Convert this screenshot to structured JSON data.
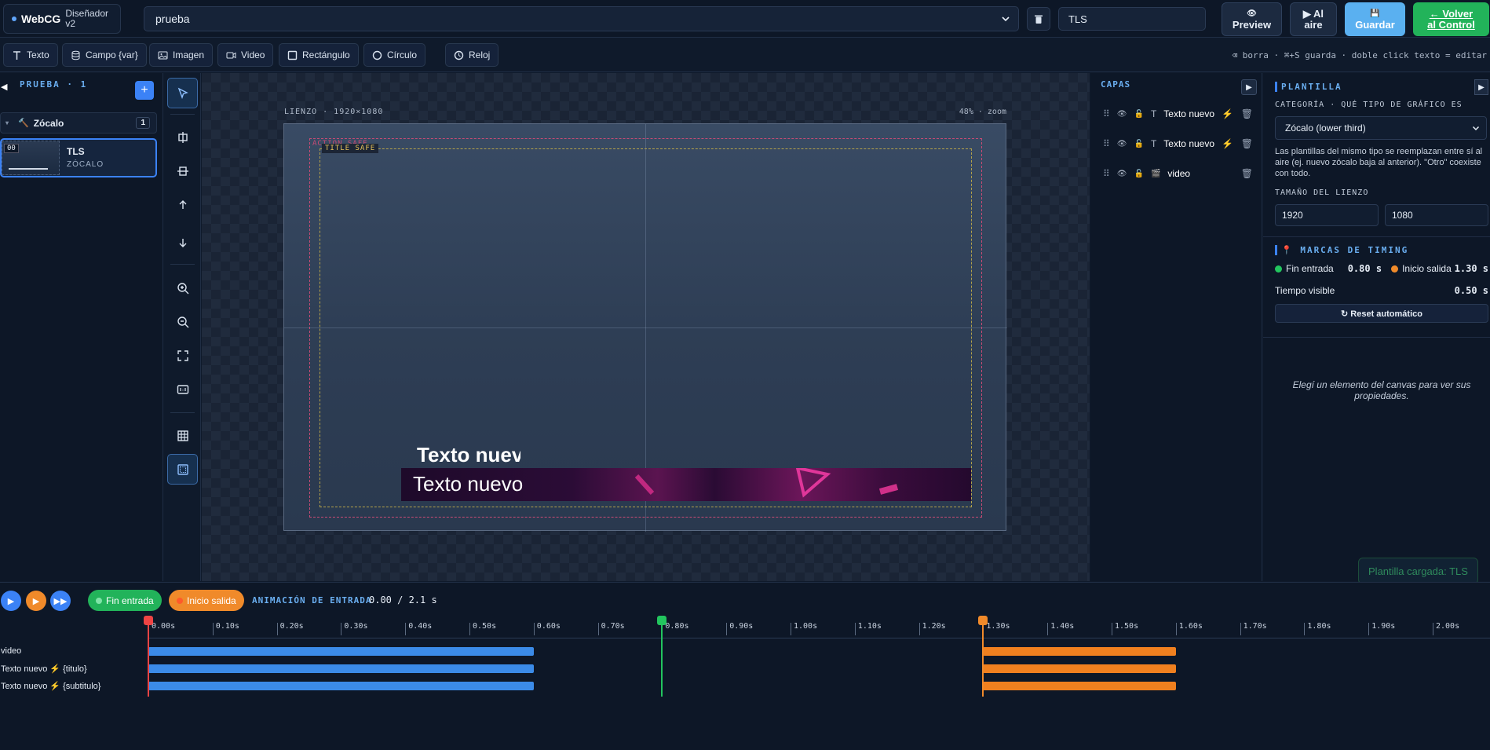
{
  "app": {
    "name": "WebCG",
    "subtitle": "Diseñador v2"
  },
  "topbar": {
    "template_selected": "prueba",
    "name_value": "TLS",
    "preview_label": "Preview",
    "aire_label1": "▶ Al",
    "aire_label2": "aire",
    "save_label": "Guardar",
    "volver_label1": "← Volver",
    "volver_label2": "al Control"
  },
  "toolbar": {
    "tools": [
      "Texto",
      "Campo {var}",
      "Imagen",
      "Video",
      "Rectángulo",
      "Círculo",
      "Reloj"
    ],
    "hint": "⌫ borra · ⌘+S guarda · doble click texto = editar"
  },
  "left": {
    "title": "PRUEBA · 1",
    "category": "Zócalo",
    "category_count": "1",
    "item_name": "TLS",
    "item_type": "ZÓCALO",
    "thumb_badge": "00"
  },
  "canvas": {
    "label": "LIENZO · 1920×1080",
    "zoom": "48% · zoom",
    "action_safe": "ACTION SAFE",
    "title_safe": "TITLE SAFE",
    "text_title": "Texto nuevo",
    "text_sub": "Texto nuevo"
  },
  "layers": {
    "title": "CAPAS",
    "items": [
      {
        "type": "T",
        "name": "Texto nuevo",
        "dynamic": true
      },
      {
        "type": "T",
        "name": "Texto nuevo",
        "dynamic": true
      },
      {
        "type": "🎬",
        "name": "video",
        "dynamic": false
      }
    ]
  },
  "props": {
    "section": "PLANTILLA",
    "category_label": "CATEGORÍA · QUÉ TIPO DE GRÁFICO ES",
    "category_value": "Zócalo (lower third)",
    "help": "Las plantillas del mismo tipo se reemplazan entre sí al aire (ej. nuevo zócalo baja al anterior). \"Otro\" coexiste con todo.",
    "size_label": "TAMAÑO DEL LIENZO",
    "width": "1920",
    "height": "1080",
    "timing_title": "📍 MARCAS DE TIMING",
    "fin_entrada_label": "Fin entrada",
    "fin_entrada_val": "0.80 s",
    "inicio_salida_label": "Inicio salida",
    "inicio_salida_val": "1.30 s",
    "visible_label": "Tiempo visible",
    "visible_val": "0.50 s",
    "reset_label": "↻ Reset automático",
    "empty_note": "Elegí un elemento del canvas para ver sus propiedades."
  },
  "toast": "Plantilla cargada: TLS",
  "timeline": {
    "fin_entrada": "Fin entrada",
    "inicio_salida": "Inicio salida",
    "anim_label": "ANIMACIÓN DE ENTRADA",
    "anim_value": "0.00 / 2.1 s",
    "ticks": [
      "0.00s",
      "0.10s",
      "0.20s",
      "0.30s",
      "0.40s",
      "0.50s",
      "0.60s",
      "0.70s",
      "0.80s",
      "0.90s",
      "1.00s",
      "1.10s",
      "1.20s",
      "1.30s",
      "1.40s",
      "1.50s",
      "1.60s",
      "1.70s",
      "1.80s",
      "1.90s",
      "2.00s"
    ],
    "tracks": [
      "video",
      "Texto nuevo ⚡ {titulo}",
      "Texto nuevo ⚡ {subtitulo}"
    ],
    "playhead_s": 0.0,
    "marker_fin_entrada_s": 0.8,
    "marker_inicio_salida_s": 1.3,
    "entry_end_s": 0.6,
    "exit_end_s": 1.6
  },
  "colors": {
    "accent": "#3b82f6",
    "green": "#22b35a",
    "orange": "#f0801f",
    "red": "#ef4444"
  }
}
